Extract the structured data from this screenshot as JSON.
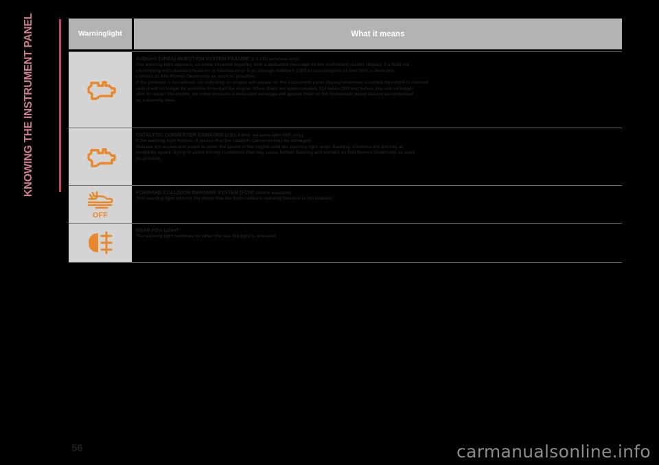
{
  "chapter": {
    "title": "KNOWING THE INSTRUMENT PANEL"
  },
  "table": {
    "headers": {
      "warning_light": "Warning\nlight",
      "what_it_means": "What it means"
    },
    "rows": [
      {
        "icon": "engine-check-icon",
        "icon_color": "#E8882A",
        "title": "AdBlue® (UREA) INJECTION SYSTEM FAILURE",
        "title_suffix": "(2.2 JTD versions only)",
        "body": [
          "The warning light appears, on some versions together with a dedicated message on the instrument cluster display, if a fluid not",
          "conforming with standard features is introduced or if an average AdBlue® (UREA) consumption of over 50% is detected.",
          "Contact an Alfa Romeo Dealership as soon as possible.",
          "If the problem is not solved, on switching on engine will appear on the instrument panel display whenever a certain threshold is reached",
          "until it will no longer be possible to restart the engine. When there are approximately 124 miles (200 km) before you will no longer",
          "able to restart the engine, on some versions a dedicated message will appear fixed on the instrument panel display accompanied",
          "by a warning tone."
        ]
      },
      {
        "icon": "engine-check-icon",
        "icon_color": "#E8882A",
        "title": "CATALYTIC CONVERTER DAMAGED",
        "title_suffix": "(2.0/1.4 MAir versions with GPF only)",
        "body": [
          "If the warning light flashes, it means that the catalytic converter may be damaged.",
          "Release the accelerator pedal to lower the speed of the engine until the warning light stops flashing. Continue the journey at",
          "moderate speed, trying to avoid driving conditions that may cause further flashing and contact an Alfa Romeo Dealership as soon",
          "as possible."
        ]
      },
      {
        "icon": "forward-collision-off-icon",
        "icon_color": "#E8882A",
        "title": "FORWARD COLLISION WARNING SYSTEM (FCW)",
        "title_suffix": "(where available)",
        "body": [
          "This warning light informs the driver that the front collision warning function is not enabled."
        ]
      },
      {
        "icon": "rear-fog-light-icon",
        "icon_color": "#E8882A",
        "title": "REAR FOG LIGHT",
        "title_suffix": "",
        "body": [
          "The warning light switches on when the rear fog light is activated."
        ]
      }
    ]
  },
  "footer": {
    "page_number": "56",
    "watermark": "carmanualsonline.info"
  }
}
